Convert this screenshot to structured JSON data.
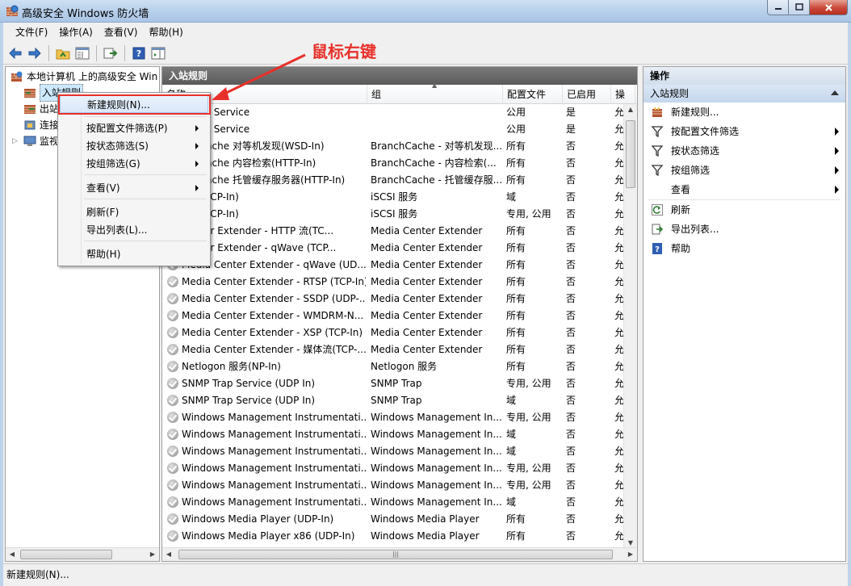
{
  "window": {
    "title": "高级安全 Windows 防火墙"
  },
  "menubar": [
    "文件(F)",
    "操作(A)",
    "查看(V)",
    "帮助(H)"
  ],
  "tree": {
    "root": "本地计算机 上的高级安全 Win",
    "items": [
      {
        "label": "入站规则",
        "selected": true
      },
      {
        "label": "出站"
      },
      {
        "label": "连接"
      },
      {
        "label": "监视"
      }
    ]
  },
  "center": {
    "header": "入站规则",
    "columns": [
      "名称",
      "组",
      "配置文件",
      "已启用",
      "操"
    ],
    "rows": [
      {
        "name": "Pinyin Service",
        "group": "",
        "profile": "公用",
        "enabled": "是",
        "action": "允"
      },
      {
        "name": "Pinyin Service",
        "group": "",
        "profile": "公用",
        "enabled": "是",
        "action": "允"
      },
      {
        "name": "nchCache 对等机发现(WSD-In)",
        "group": "BranchCache - 对等机发现...",
        "profile": "所有",
        "enabled": "否",
        "action": "允"
      },
      {
        "name": "nchCache 内容检索(HTTP-In)",
        "group": "BranchCache - 内容检索(...",
        "profile": "所有",
        "enabled": "否",
        "action": "允"
      },
      {
        "name": "nchCache 托管缓存服务器(HTTP-In)",
        "group": "BranchCache - 托管缓存服...",
        "profile": "所有",
        "enabled": "否",
        "action": "允"
      },
      {
        "name": "服务(TCP-In)",
        "group": "iSCSI 服务",
        "profile": "域",
        "enabled": "否",
        "action": "允"
      },
      {
        "name": "服务(TCP-In)",
        "group": "iSCSI 服务",
        "profile": "专用, 公用",
        "enabled": "否",
        "action": "允"
      },
      {
        "name": "Center Extender - HTTP 流(TC...",
        "group": "Media Center Extender",
        "profile": "所有",
        "enabled": "否",
        "action": "允"
      },
      {
        "name": "Center Extender - qWave (TCP...",
        "group": "Media Center Extender",
        "profile": "所有",
        "enabled": "否",
        "action": "允"
      },
      {
        "name": "Media Center Extender - qWave (UD...",
        "group": "Media Center Extender",
        "profile": "所有",
        "enabled": "否",
        "action": "允"
      },
      {
        "name": "Media Center Extender - RTSP (TCP-In)",
        "group": "Media Center Extender",
        "profile": "所有",
        "enabled": "否",
        "action": "允"
      },
      {
        "name": "Media Center Extender - SSDP (UDP-...",
        "group": "Media Center Extender",
        "profile": "所有",
        "enabled": "否",
        "action": "允"
      },
      {
        "name": "Media Center Extender - WMDRM-N...",
        "group": "Media Center Extender",
        "profile": "所有",
        "enabled": "否",
        "action": "允"
      },
      {
        "name": "Media Center Extender - XSP (TCP-In)",
        "group": "Media Center Extender",
        "profile": "所有",
        "enabled": "否",
        "action": "允"
      },
      {
        "name": "Media Center Extender - 媒体流(TCP-...",
        "group": "Media Center Extender",
        "profile": "所有",
        "enabled": "否",
        "action": "允"
      },
      {
        "name": "Netlogon 服务(NP-In)",
        "group": "Netlogon 服务",
        "profile": "所有",
        "enabled": "否",
        "action": "允"
      },
      {
        "name": "SNMP Trap Service (UDP In)",
        "group": "SNMP Trap",
        "profile": "专用, 公用",
        "enabled": "否",
        "action": "允"
      },
      {
        "name": "SNMP Trap Service (UDP In)",
        "group": "SNMP Trap",
        "profile": "域",
        "enabled": "否",
        "action": "允"
      },
      {
        "name": "Windows Management Instrumentati...",
        "group": "Windows Management In...",
        "profile": "专用, 公用",
        "enabled": "否",
        "action": "允"
      },
      {
        "name": "Windows Management Instrumentati...",
        "group": "Windows Management In...",
        "profile": "域",
        "enabled": "否",
        "action": "允"
      },
      {
        "name": "Windows Management Instrumentati...",
        "group": "Windows Management In...",
        "profile": "域",
        "enabled": "否",
        "action": "允"
      },
      {
        "name": "Windows Management Instrumentati...",
        "group": "Windows Management In...",
        "profile": "专用, 公用",
        "enabled": "否",
        "action": "允"
      },
      {
        "name": "Windows Management Instrumentati...",
        "group": "Windows Management In...",
        "profile": "专用, 公用",
        "enabled": "否",
        "action": "允"
      },
      {
        "name": "Windows Management Instrumentati...",
        "group": "Windows Management In...",
        "profile": "域",
        "enabled": "否",
        "action": "允"
      },
      {
        "name": "Windows Media Player (UDP-In)",
        "group": "Windows Media Player",
        "profile": "所有",
        "enabled": "否",
        "action": "允"
      },
      {
        "name": "Windows Media Player x86 (UDP-In)",
        "group": "Windows Media Player",
        "profile": "所有",
        "enabled": "否",
        "action": "允"
      }
    ]
  },
  "actions": {
    "header": "操作",
    "section": "入站规则",
    "items": [
      {
        "label": "新建规则...",
        "icon": "new-rule-icon"
      },
      {
        "label": "按配置文件筛选",
        "icon": "filter-icon",
        "submenu": true
      },
      {
        "label": "按状态筛选",
        "icon": "filter-icon",
        "submenu": true
      },
      {
        "label": "按组筛选",
        "icon": "filter-icon",
        "submenu": true
      },
      {
        "label": "查看",
        "icon": "",
        "submenu": true
      },
      {
        "label": "刷新",
        "icon": "refresh-icon"
      },
      {
        "label": "导出列表...",
        "icon": "export-icon"
      },
      {
        "label": "帮助",
        "icon": "help-icon"
      }
    ]
  },
  "context_menu": {
    "items": [
      {
        "label": "新建规则(N)...",
        "highlighted": true
      },
      {
        "label": "按配置文件筛选(P)",
        "submenu": true
      },
      {
        "label": "按状态筛选(S)",
        "submenu": true
      },
      {
        "label": "按组筛选(G)",
        "submenu": true
      },
      {
        "label": "查看(V)",
        "submenu": true
      },
      {
        "label": "刷新(F)"
      },
      {
        "label": "导出列表(L)..."
      },
      {
        "label": "帮助(H)"
      }
    ]
  },
  "annotation": "鼠标右键",
  "status": "新建规则(N)...",
  "colors": {
    "annotation": "#e8302a",
    "selection": "#cce8ff",
    "panel_header": "#5a5a5a"
  }
}
